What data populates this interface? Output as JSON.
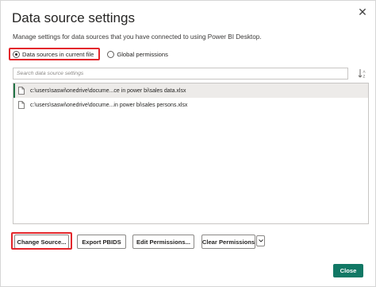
{
  "dialog": {
    "title": "Data source settings",
    "description": "Manage settings for data sources that you have connected to using Power BI Desktop.",
    "close_icon": "close-icon"
  },
  "scope": {
    "options": [
      {
        "label": "Data sources in current file",
        "selected": true
      },
      {
        "label": "Global permissions",
        "selected": false
      }
    ]
  },
  "search": {
    "placeholder": "Search data source settings",
    "sort_icon": "sort-icon"
  },
  "data_sources": [
    {
      "path": "c:\\users\\saswi\\onedrive\\docume...ce in power bi\\sales data.xlsx",
      "icon": "file-icon",
      "selected": true
    },
    {
      "path": "c:\\users\\saswi\\onedrive\\docume...in power bi\\sales persons.xlsx",
      "icon": "file-icon",
      "selected": false
    }
  ],
  "actions": {
    "change_source": "Change Source...",
    "export_pbids": "Export PBIDS",
    "edit_permissions": "Edit Permissions...",
    "clear_permissions": "Clear Permissions",
    "dropdown_icon": "chevron-down-icon"
  },
  "footer": {
    "close": "Close"
  },
  "colors": {
    "accent": "#117865",
    "highlight": "#e3262b",
    "selected_row": "#edebe9"
  }
}
